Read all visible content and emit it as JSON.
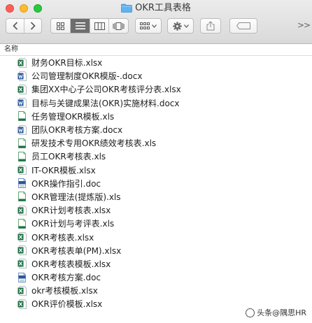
{
  "window": {
    "title": "OKR工具表格"
  },
  "toolbar": {
    "back_icon": "chevron-left-icon",
    "forward_icon": "chevron-right-icon",
    "views": [
      "icon-view",
      "list-view",
      "column-view",
      "cover-flow-view"
    ],
    "active_view": "list-view",
    "arrange_icon": "arrange-grid-icon",
    "action_icon": "gear-icon",
    "share_icon": "share-icon",
    "tag_icon": "tag-icon"
  },
  "column_header": {
    "name": "名称"
  },
  "files": [
    {
      "name": "财务OKR目标.xlsx",
      "type": "xlsx"
    },
    {
      "name": "公司管理制度OKR模版-.docx",
      "type": "docx"
    },
    {
      "name": "集团XX中心子公司OKR考核评分表.xlsx",
      "type": "xlsx"
    },
    {
      "name": "目标与关键成果法(OKR)实施材料.docx",
      "type": "docx"
    },
    {
      "name": "任务管理OKR模板.xls",
      "type": "xls"
    },
    {
      "name": "团队OKR考核方案.docx",
      "type": "docx"
    },
    {
      "name": "研发技术专用OKR绩效考核表.xls",
      "type": "xls"
    },
    {
      "name": "员工OKR考核表.xls",
      "type": "xls"
    },
    {
      "name": "IT-OKR模板.xlsx",
      "type": "xlsx"
    },
    {
      "name": "OKR操作指引.doc",
      "type": "doc"
    },
    {
      "name": "OKR管理法(提炼版).xls",
      "type": "xls"
    },
    {
      "name": "OKR计划考核表.xlsx",
      "type": "xlsx"
    },
    {
      "name": "OKR计划与考评表.xls",
      "type": "xls"
    },
    {
      "name": "OKR考核表.xlsx",
      "type": "xlsx"
    },
    {
      "name": "OKR考核表单(PM).xlsx",
      "type": "xlsx"
    },
    {
      "name": "OKR考核表模板.xlsx",
      "type": "xlsx"
    },
    {
      "name": "OKR考核方案.doc",
      "type": "doc"
    },
    {
      "name": "okr考核模板.xlsx",
      "type": "xlsx"
    },
    {
      "name": "OKR评价模板.xlsx",
      "type": "xlsx"
    }
  ],
  "watermark": {
    "text": "头条@隅思HR"
  },
  "colors": {
    "excel": "#1e7145",
    "word": "#2b579a",
    "folder": "#5fb3f0",
    "close": "#fc5f57",
    "minimize": "#fdbc2e",
    "zoom": "#28c840"
  }
}
